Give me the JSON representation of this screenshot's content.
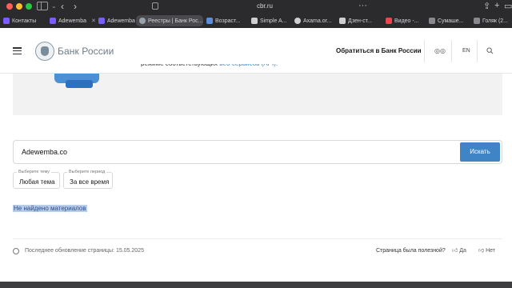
{
  "browser": {
    "url": "cbr.ru",
    "tabs": [
      {
        "label": "Контакты",
        "color": "#7b5cff"
      },
      {
        "label": "Adewemba",
        "color": "#7b5cff"
      },
      {
        "label": "Adewemba",
        "color": "#7b5cff"
      },
      {
        "label": "Реестры | Банк Рос...",
        "color": "#9aa3ad",
        "active": true
      },
      {
        "label": "Возраст...",
        "color": "#5b8fd9"
      },
      {
        "label": "Simple A...",
        "color": "#cfcfcf"
      },
      {
        "label": "Axama.or...",
        "color": "#cfcfcf"
      },
      {
        "label": "Дзен-ст...",
        "color": "#cfcfcf"
      },
      {
        "label": "Видео -...",
        "color": "#e5484d"
      },
      {
        "label": "Сумаше...",
        "color": "#8a8a8e"
      },
      {
        "label": "Голяк (2...",
        "color": "#8a8a8e"
      }
    ]
  },
  "header": {
    "brand": "Банк России",
    "contact": "Обратиться в Банк России",
    "lang": "EN"
  },
  "intro": {
    "text_before": "режиме соответствующих ",
    "link": "веб-сервисов (API)."
  },
  "search": {
    "value": "Adewemba.co",
    "button": "Искать"
  },
  "filters": [
    {
      "label": "Выберите тему",
      "value": "Любая тема"
    },
    {
      "label": "Выберите период",
      "value": "За все время"
    }
  ],
  "results": {
    "message": "Не найдено материалов"
  },
  "footer": {
    "updated": "Последнее обновление страницы: 15.05.2025",
    "useful_question": "Страница была полезной?",
    "yes": "Да",
    "no": "Нет"
  }
}
